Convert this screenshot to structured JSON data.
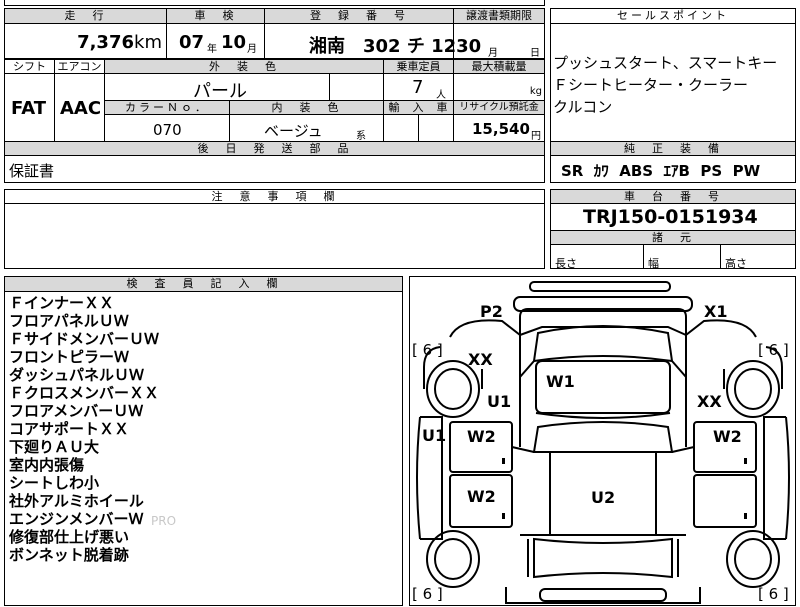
{
  "top": {
    "mileage_label": "走　行",
    "mileage_value": "7,376",
    "mileage_unit": "km",
    "inspection_label": "車　検",
    "inspection_year": "07",
    "inspection_year_unit": "年",
    "inspection_month": "10",
    "inspection_month_unit": "月",
    "plate_label": "登　録　番　号",
    "plate_value": "湘南　302 チ 1230",
    "transfer_label": "譲渡書類期限",
    "transfer_month_unit": "月",
    "transfer_day_unit": "日",
    "selling_label": "セールスポイント",
    "selling_lines": [
      "プッシュスタート、スマートキー",
      "Ｆシートヒーター・クーラー",
      "クルコン"
    ]
  },
  "row2": {
    "shift_label": "シフト",
    "shift_value": "FAT",
    "ac_label": "エアコン",
    "ac_value": "AAC",
    "exterior_color_label": "外　装　色",
    "exterior_color_value": "パール",
    "capacity_label": "乗車定員",
    "capacity_value": "7",
    "capacity_unit": "人",
    "max_load_label": "最大積載量",
    "max_load_unit": "kg",
    "color_no_label": "カラーＮｏ．",
    "color_no_value": "070",
    "interior_color_label": "内　装　色",
    "interior_color_value": "ベージュ",
    "interior_suffix": "系",
    "import_label": "輸　入　車",
    "recycle_label": "リサイクル預託金",
    "recycle_value": "15,540",
    "recycle_unit": "円"
  },
  "equipment": {
    "label": "純　正　装　備",
    "value": "SR  ｶﾜ  ABS  ｴｱB  PS  PW"
  },
  "later_parts": {
    "label": "後　日　発　送　部　品",
    "value": "保証書"
  },
  "caution": {
    "label": "注　意　事　項　欄"
  },
  "chassis": {
    "label": "車　台　番　号",
    "value": "TRJ150-0151934",
    "dims_label": "諸　元",
    "length_label": "長さ",
    "width_label": "幅",
    "height_label": "高さ"
  },
  "inspector": {
    "label": "検　査　員　記　入　欄",
    "notes": [
      "ＦインナーＸＸ",
      "フロアパネルＵＷ",
      "ＦサイドメンバーＵＷ",
      "フロントピラーＷ",
      "ダッシュパネルＵＷ",
      "ＦクロスメンバーＸＸ",
      "フロアメンバーＵＷ",
      "コアサポートＸＸ",
      "下廻りＡＵ大",
      "室内内張傷",
      "シートしわ小",
      "社外アルミホイール",
      "エンジンメンバーＷ",
      "修復部仕上げ悪い",
      "ボンネット脱着跡"
    ],
    "watermark": "PRO"
  },
  "diagram": {
    "marks": {
      "p2": "P2",
      "x1": "X1",
      "xx_left": "XX",
      "xx_right": "XX",
      "w1": "W1",
      "u1_center": "U1",
      "u1_left": "U1",
      "w2_left_top": "W2",
      "w2_left_bottom": "W2",
      "w2_right": "W2",
      "u2": "U2"
    },
    "tread": "[ 6 ]"
  }
}
